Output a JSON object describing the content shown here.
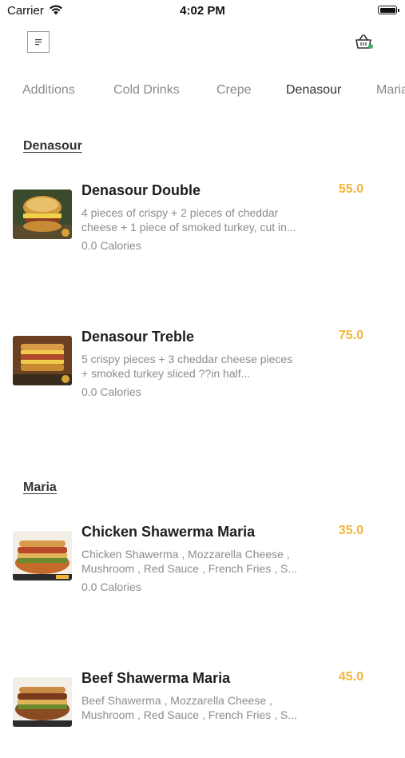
{
  "status": {
    "carrier": "Carrier",
    "time": "4:02 PM"
  },
  "tabs": [
    "Additions",
    "Cold Drinks",
    "Crepe",
    "Denasour",
    "Maria"
  ],
  "active_tab_index": 3,
  "colors": {
    "price": "#f2b63a",
    "muted": "#8c8c8c",
    "title": "#1e1e1e",
    "cart_dot": "#3bb36b"
  },
  "icons": {
    "menu": "menu-icon",
    "cart": "shopping-basket-icon",
    "wifi": "wifi-icon",
    "battery": "battery-icon"
  },
  "sections": [
    {
      "title": "Denasour",
      "items": [
        {
          "name": "Denasour Double",
          "price": "55.0",
          "description": "4 pieces of crispy + 2 pieces of cheddar\ncheese + 1 piece of smoked turkey, cut in...",
          "calories": "0.0 Calories"
        },
        {
          "name": "Denasour Treble",
          "price": "75.0",
          "description": "5 crispy pieces + 3 cheddar cheese pieces\n+ smoked turkey sliced ??in half...",
          "calories": "0.0 Calories"
        }
      ]
    },
    {
      "title": "Maria",
      "items": [
        {
          "name": "Chicken Shawerma Maria",
          "price": "35.0",
          "description": "Chicken Shawerma , Mozzarella Cheese ,\nMushroom , Red Sauce , French Fries , S...",
          "calories": "0.0 Calories"
        },
        {
          "name": "Beef Shawerma Maria",
          "price": "45.0",
          "description": "Beef Shawerma , Mozzarella Cheese ,\nMushroom , Red Sauce , French Fries , S...",
          "calories": ""
        }
      ]
    }
  ]
}
